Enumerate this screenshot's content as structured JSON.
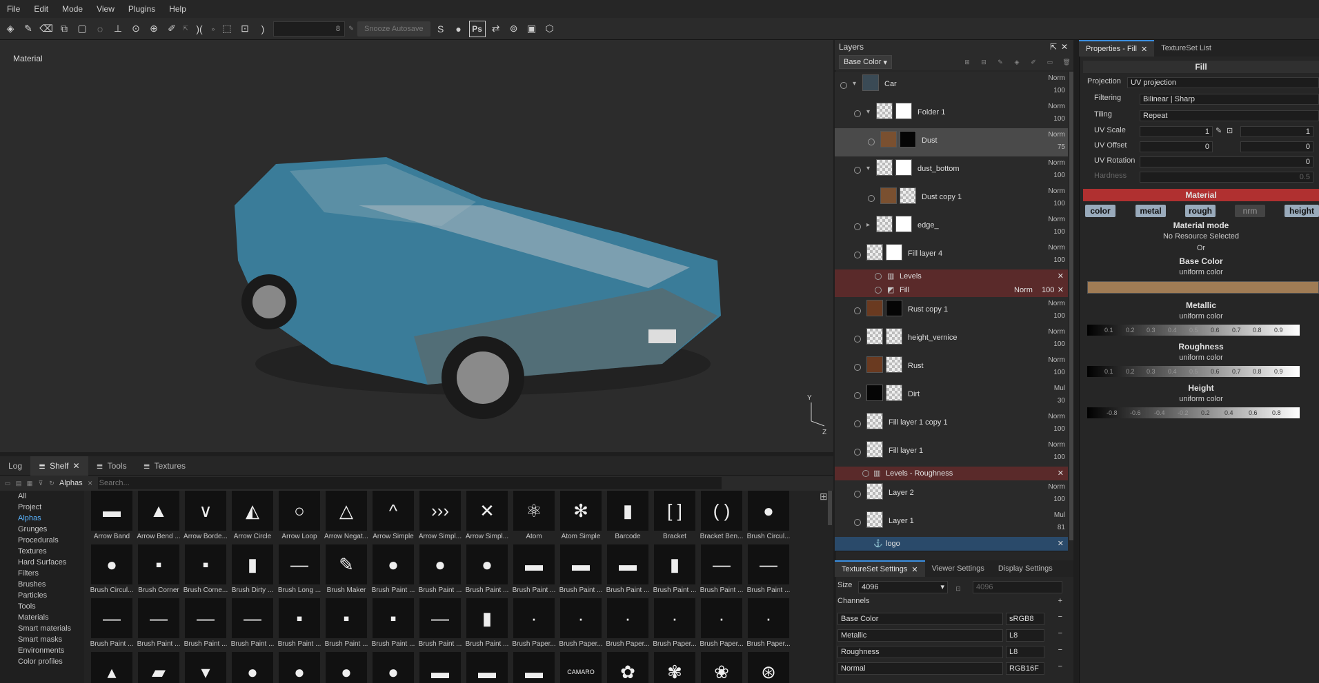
{
  "menu": [
    "File",
    "Edit",
    "Mode",
    "View",
    "Plugins",
    "Help"
  ],
  "toolbar": {
    "stroke_value": "8",
    "autosave_label": "Snooze Autosave",
    "ps_label": "Ps"
  },
  "viewport": {
    "label": "Material",
    "axis_y": "Y",
    "axis_z": "Z"
  },
  "shelf": {
    "tabs": [
      "Log",
      "Shelf",
      "Tools",
      "Textures"
    ],
    "filter_tag": "Alphas",
    "search_placeholder": "Search...",
    "categories": [
      "All",
      "Project",
      "Alphas",
      "Grunges",
      "Procedurals",
      "Textures",
      "Hard Surfaces",
      "Filters",
      "Brushes",
      "Particles",
      "Tools",
      "Materials",
      "Smart materials",
      "Smart masks",
      "Environments",
      "Color profiles"
    ],
    "active_category": "Alphas",
    "items": [
      {
        "label": "Arrow Band",
        "glyph": "▬"
      },
      {
        "label": "Arrow Bend ...",
        "glyph": "▲"
      },
      {
        "label": "Arrow Borde...",
        "glyph": "∨"
      },
      {
        "label": "Arrow Circle",
        "glyph": "◭"
      },
      {
        "label": "Arrow Loop",
        "glyph": "○"
      },
      {
        "label": "Arrow Negat...",
        "glyph": "△"
      },
      {
        "label": "Arrow Simple",
        "glyph": "^"
      },
      {
        "label": "Arrow Simpl...",
        "glyph": "›››"
      },
      {
        "label": "Arrow Simpl...",
        "glyph": "✕"
      },
      {
        "label": "Atom",
        "glyph": "⚛"
      },
      {
        "label": "Atom Simple",
        "glyph": "✻"
      },
      {
        "label": "Barcode",
        "glyph": "▮"
      },
      {
        "label": "Bracket",
        "glyph": "[ ]"
      },
      {
        "label": "Bracket Ben...",
        "glyph": "( )"
      },
      {
        "label": "Brush Circul...",
        "glyph": "●"
      },
      {
        "label": "Brush Circul...",
        "glyph": "●"
      },
      {
        "label": "Brush Corner",
        "glyph": "▪"
      },
      {
        "label": "Brush Corne...",
        "glyph": "▪"
      },
      {
        "label": "Brush Dirty ...",
        "glyph": "▮"
      },
      {
        "label": "Brush Long ...",
        "glyph": "—"
      },
      {
        "label": "Brush Maker",
        "glyph": "✎"
      },
      {
        "label": "Brush Paint ...",
        "glyph": "●"
      },
      {
        "label": "Brush Paint ...",
        "glyph": "●"
      },
      {
        "label": "Brush Paint ...",
        "glyph": "●"
      },
      {
        "label": "Brush Paint ...",
        "glyph": "▬"
      },
      {
        "label": "Brush Paint ...",
        "glyph": "▬"
      },
      {
        "label": "Brush Paint ...",
        "glyph": "▬"
      },
      {
        "label": "Brush Paint ...",
        "glyph": "▮"
      },
      {
        "label": "Brush Paint ...",
        "glyph": "—"
      },
      {
        "label": "Brush Paint ...",
        "glyph": "—"
      },
      {
        "label": "Brush Paint ...",
        "glyph": "—"
      },
      {
        "label": "Brush Paint ...",
        "glyph": "—"
      },
      {
        "label": "Brush Paint ...",
        "glyph": "—"
      },
      {
        "label": "Brush Paint ...",
        "glyph": "—"
      },
      {
        "label": "Brush Paint ...",
        "glyph": "▪"
      },
      {
        "label": "Brush Paint ...",
        "glyph": "▪"
      },
      {
        "label": "Brush Paint ...",
        "glyph": "▪"
      },
      {
        "label": "Brush Paint ...",
        "glyph": "—"
      },
      {
        "label": "Brush Paint ...",
        "glyph": "▮"
      },
      {
        "label": "Brush Paper...",
        "glyph": "·"
      },
      {
        "label": "Brush Paper...",
        "glyph": "·"
      },
      {
        "label": "Brush Paper...",
        "glyph": "·"
      },
      {
        "label": "Brush Paper...",
        "glyph": "·"
      },
      {
        "label": "Brush Paper...",
        "glyph": "·"
      },
      {
        "label": "Brush Paper...",
        "glyph": "·"
      },
      {
        "label": "",
        "glyph": "▴"
      },
      {
        "label": "",
        "glyph": "▰"
      },
      {
        "label": "",
        "glyph": "▾"
      },
      {
        "label": "",
        "glyph": "●"
      },
      {
        "label": "",
        "glyph": "●"
      },
      {
        "label": "",
        "glyph": "●"
      },
      {
        "label": "",
        "glyph": "●"
      },
      {
        "label": "",
        "glyph": "▬"
      },
      {
        "label": "",
        "glyph": "▬"
      },
      {
        "label": "",
        "glyph": "▬"
      },
      {
        "label": "",
        "glyph": "CAMARO"
      },
      {
        "label": "",
        "glyph": "✿"
      },
      {
        "label": "",
        "glyph": "✾"
      },
      {
        "label": "",
        "glyph": "❀"
      },
      {
        "label": "",
        "glyph": "⊛"
      }
    ]
  },
  "layers": {
    "title": "Layers",
    "channel": "Base Color",
    "rows": [
      {
        "name": "Car",
        "blend": "Norm",
        "opacity": "100",
        "thumb": "car",
        "mask": ""
      },
      {
        "name": "Folder 1",
        "blend": "Norm",
        "opacity": "100",
        "thumb": "check",
        "mask": "white"
      },
      {
        "name": "Dust",
        "blend": "Norm",
        "opacity": "75",
        "thumb": "dust",
        "mask": "black"
      },
      {
        "name": "dust_bottom",
        "blend": "Norm",
        "opacity": "100",
        "thumb": "check",
        "mask": "white"
      },
      {
        "name": "Dust copy 1",
        "blend": "Norm",
        "opacity": "100",
        "thumb": "dust",
        "mask": "check"
      },
      {
        "name": "edge_",
        "blend": "Norm",
        "opacity": "100",
        "thumb": "check",
        "mask": "white"
      },
      {
        "name": "Fill layer 4",
        "blend": "Norm",
        "opacity": "100",
        "thumb": "check",
        "mask": "white"
      },
      {
        "name": "Rust copy 1",
        "blend": "Norm",
        "opacity": "100",
        "thumb": "rust",
        "mask": "black"
      },
      {
        "name": "height_vernice",
        "blend": "Norm",
        "opacity": "100",
        "thumb": "check",
        "mask": "check"
      },
      {
        "name": "Rust",
        "blend": "Norm",
        "opacity": "100",
        "thumb": "rust",
        "mask": "check"
      },
      {
        "name": "Dirt",
        "blend": "Mul",
        "opacity": "30",
        "thumb": "black",
        "mask": "check"
      },
      {
        "name": "Fill layer 1 copy 1",
        "blend": "Norm",
        "opacity": "100",
        "thumb": "check",
        "mask": ""
      },
      {
        "name": "Fill layer 1",
        "blend": "Norm",
        "opacity": "100",
        "thumb": "check",
        "mask": ""
      },
      {
        "name": "Layer 2",
        "blend": "Norm",
        "opacity": "100",
        "thumb": "check",
        "mask": ""
      },
      {
        "name": "Layer 1",
        "blend": "Mul",
        "opacity": "81",
        "thumb": "check",
        "mask": ""
      }
    ],
    "sub_levels": "Levels",
    "sub_fill": "Fill",
    "sub_fill_blend": "Norm",
    "sub_fill_opacity": "100",
    "sub_levels_rough": "Levels - Roughness",
    "sub_logo": "logo"
  },
  "textureset": {
    "tabs": [
      "TextureSet Settings",
      "Viewer Settings",
      "Display Settings"
    ],
    "size_label": "Size",
    "size_value": "4096",
    "size_value2": "4096",
    "channels_label": "Channels",
    "channels": [
      {
        "name": "Base Color",
        "format": "sRGB8"
      },
      {
        "name": "Metallic",
        "format": "L8"
      },
      {
        "name": "Roughness",
        "format": "L8"
      },
      {
        "name": "Normal",
        "format": "RGB16F"
      }
    ]
  },
  "properties": {
    "tabs": [
      "Properties - Fill",
      "TextureSet List"
    ],
    "fill_title": "Fill",
    "projection_label": "Projection",
    "projection_value": "UV projection",
    "filtering_label": "Filtering",
    "filtering_value": "Bilinear | Sharp",
    "tiling_label": "Tiling",
    "tiling_value": "Repeat",
    "uvscale_label": "UV Scale",
    "uvscale_value": "1",
    "uvscale_value2": "1",
    "uvoffset_label": "UV Offset",
    "uvoffset_value": "0",
    "uvoffset_value2": "0",
    "uvrotation_label": "UV Rotation",
    "uvrotation_value": "0",
    "hardness_label": "Hardness",
    "hardness_value": "0.5",
    "material_title": "Material",
    "chips": [
      "color",
      "metal",
      "rough",
      "nrm",
      "height"
    ],
    "material_mode": "Material mode",
    "no_resource": "No Resource Selected",
    "or": "Or",
    "base_color": "Base Color",
    "uniform": "uniform color",
    "metallic": "Metallic",
    "roughness": "Roughness",
    "height": "Height",
    "ramp_ticks": [
      "0.1",
      "0.2",
      "0.3",
      "0.4",
      "0.5",
      "0.6",
      "0.7",
      "0.8",
      "0.9"
    ],
    "height_ticks": [
      "-0.8",
      "-0.6",
      "-0.4",
      "-0.2",
      "0.2",
      "0.4",
      "0.6",
      "0.8"
    ],
    "base_color_swatch": "#a07c55"
  }
}
